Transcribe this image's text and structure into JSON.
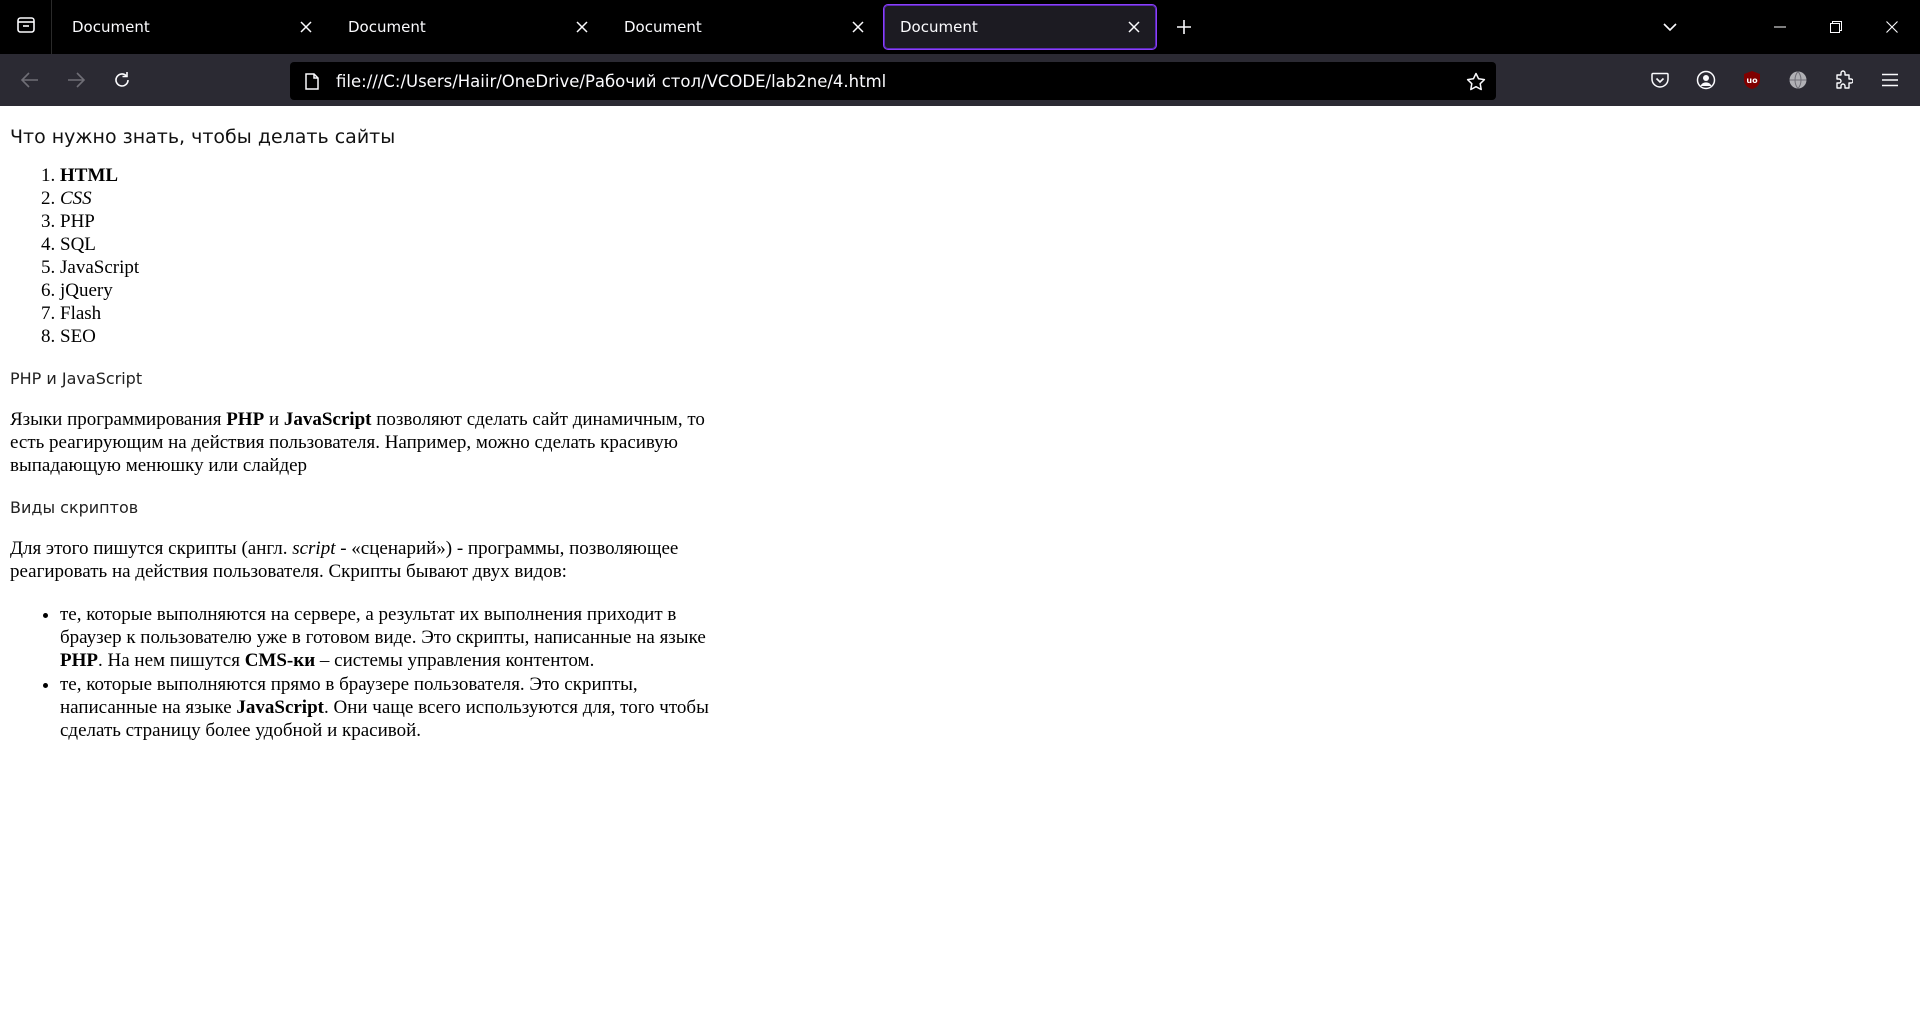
{
  "browser": {
    "tabs": [
      {
        "title": "Document",
        "active": false
      },
      {
        "title": "Document",
        "active": false
      },
      {
        "title": "Document",
        "active": false
      },
      {
        "title": "Document",
        "active": true
      }
    ],
    "url": "file:///C:/Users/Haiir/OneDrive/Рабочий стол/VCODE/lab2ne/4.html",
    "accent_color": "#8a3ffc",
    "icons": {
      "tab_list": "firefox-view-icon",
      "new_tab": "plus-icon",
      "list_all_tabs": "chevron-down-icon",
      "back": "back-arrow-icon",
      "forward": "forward-arrow-icon",
      "reload": "reload-icon",
      "page": "page-icon",
      "bookmark": "star-icon",
      "pocket": "pocket-icon",
      "account": "account-icon",
      "ublock": "ublock-origin-icon",
      "vpn": "globe-icon",
      "extensions": "puzzle-icon",
      "menu": "hamburger-menu-icon"
    }
  },
  "page": {
    "heading": "Что нужно знать, чтобы делать сайты",
    "tech_list": [
      "HTML",
      "CSS",
      "PHP",
      "SQL",
      "JavaScript",
      "jQuery",
      "Flash",
      "SEO"
    ],
    "section1_title": "PHP и JavaScript",
    "para1": {
      "t1": "Языки программирования ",
      "b1": "PHP",
      "t2": " и ",
      "b2": "JavaScript",
      "t3": " позволяют сделать сайт динамичным, то есть реагирующим на действия пользователя. Например, можно сделать красивую выпадающую менюшку или слайдер"
    },
    "section2_title": "Виды скриптов",
    "para2": {
      "t1": "Для этого пишутся скрипты (англ. ",
      "i1": "script",
      "t2": " - «сценарий») - программы, позволяющее реагировать на действия пользователя. Скрипты бывают двух видов:"
    },
    "script_types": [
      {
        "t1": "те, которые выполняются на сервере, а результат их выполнения приходит в браузер к пользователю уже в готовом виде. Это скрипты, написанные на языке ",
        "b1": "PHP",
        "t2": ". На нем пишутся ",
        "b2": "CMS-ки",
        "t3": " – системы управления контентом."
      },
      {
        "t1": "те, которые выполняются прямо в браузере пользователя. Это скрипты, написанные на языке ",
        "b1": "JavaScript",
        "t2": ". Они чаще всего используются для, того чтобы сделать страницу более удобной и красивой."
      }
    ]
  }
}
